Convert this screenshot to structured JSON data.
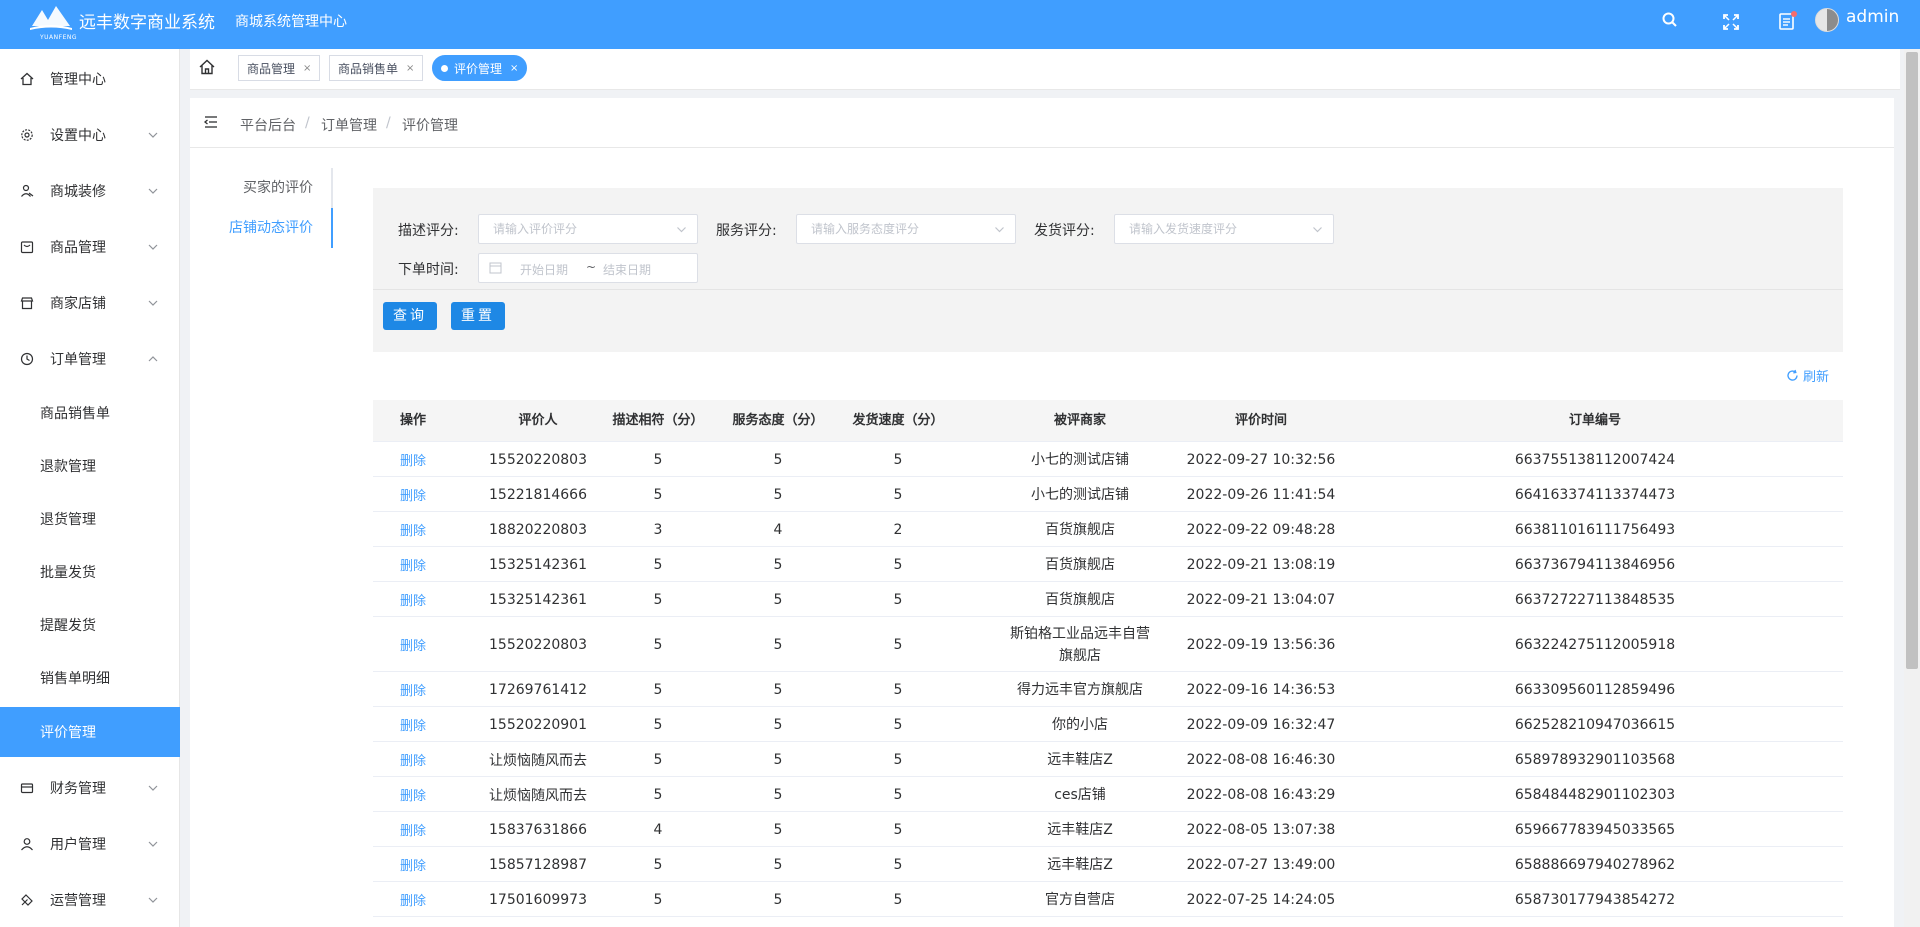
{
  "header": {
    "app_title": "远丰数字商业系统",
    "center_title": "商城系统管理中心",
    "logo_sub": "YUANFENG",
    "username": "admin",
    "icons": [
      "search-icon",
      "fullscreen-icon",
      "message-icon"
    ]
  },
  "sidebar": {
    "items": [
      {
        "label": "管理中心",
        "icon": "home-icon"
      },
      {
        "label": "设置中心",
        "icon": "gear-icon"
      },
      {
        "label": "商城装修",
        "icon": "decoration-icon"
      },
      {
        "label": "商品管理",
        "icon": "goods-icon"
      },
      {
        "label": "商家店铺",
        "icon": "shop-icon"
      },
      {
        "label": "订单管理",
        "icon": "order-icon"
      },
      {
        "label": "财务管理",
        "icon": "finance-icon"
      },
      {
        "label": "用户管理",
        "icon": "user-icon"
      },
      {
        "label": "运营管理",
        "icon": "operation-icon"
      }
    ],
    "sub_items": [
      "商品销售单",
      "退款管理",
      "退货管理",
      "批量发货",
      "提醒发货",
      "销售单明细",
      "评价管理"
    ]
  },
  "tabs": [
    {
      "label": "商品管理"
    },
    {
      "label": "商品销售单"
    },
    {
      "label": "评价管理"
    }
  ],
  "breadcrumb": [
    "平台后台",
    "订单管理",
    "评价管理"
  ],
  "side_tabs": [
    "买家的评价",
    "店铺动态评价"
  ],
  "filters": {
    "desc_label": "描述评分:",
    "desc_placeholder": "请输入评价评分",
    "service_label": "服务评分:",
    "service_placeholder": "请输入服务态度评分",
    "ship_label": "发货评分:",
    "ship_placeholder": "请输入发货速度评分",
    "time_label": "下单时间:",
    "date_start": "开始日期",
    "date_sep": "~",
    "date_end": "结束日期",
    "query_button": "查询",
    "reset_button": "重置"
  },
  "refresh_label": "刷新",
  "colors": {
    "primary": "#409eff",
    "button": "#1e88e5"
  },
  "table": {
    "columns": [
      "操作",
      "评价人",
      "描述相符（分）",
      "服务态度（分）",
      "发货速度（分）",
      "被评商家",
      "评价时间",
      "订单编号"
    ],
    "rows": [
      [
        "删除",
        "15520220803",
        "5",
        "5",
        "5",
        "小七的测试店铺",
        "2022-09-27 10:32:56",
        "663755138112007424"
      ],
      [
        "删除",
        "15221814666",
        "5",
        "5",
        "5",
        "小七的测试店铺",
        "2022-09-26 11:41:54",
        "664163374113374473"
      ],
      [
        "删除",
        "18820220803",
        "3",
        "4",
        "2",
        "百货旗舰店",
        "2022-09-22 09:48:28",
        "663811016111756493"
      ],
      [
        "删除",
        "15325142361",
        "5",
        "5",
        "5",
        "百货旗舰店",
        "2022-09-21 13:08:19",
        "663736794113846956"
      ],
      [
        "删除",
        "15325142361",
        "5",
        "5",
        "5",
        "百货旗舰店",
        "2022-09-21 13:04:07",
        "663727227113848535"
      ],
      [
        "删除",
        "15520220803",
        "5",
        "5",
        "5",
        "斯铂格工业品远丰自营旗舰店",
        "2022-09-19 13:56:36",
        "663224275112005918"
      ],
      [
        "删除",
        "17269761412",
        "5",
        "5",
        "5",
        "得力远丰官方旗舰店",
        "2022-09-16 14:36:53",
        "663309560112859496"
      ],
      [
        "删除",
        "15520220901",
        "5",
        "5",
        "5",
        "你的小店",
        "2022-09-09 16:32:47",
        "662528210947036615"
      ],
      [
        "删除",
        "让烦恼随风而去",
        "5",
        "5",
        "5",
        "远丰鞋店Z",
        "2022-08-08 16:46:30",
        "658978932901103568"
      ],
      [
        "删除",
        "让烦恼随风而去",
        "5",
        "5",
        "5",
        "ces店铺",
        "2022-08-08 16:43:29",
        "658484482901102303"
      ],
      [
        "删除",
        "15837631866",
        "4",
        "5",
        "5",
        "远丰鞋店Z",
        "2022-08-05 13:07:38",
        "659667783945033565"
      ],
      [
        "删除",
        "15857128987",
        "5",
        "5",
        "5",
        "远丰鞋店Z",
        "2022-07-27 13:49:00",
        "658886697940278962"
      ],
      [
        "删除",
        "17501609973",
        "5",
        "5",
        "5",
        "官方自营店",
        "2022-07-25 14:24:05",
        "658730177943854272"
      ]
    ]
  }
}
